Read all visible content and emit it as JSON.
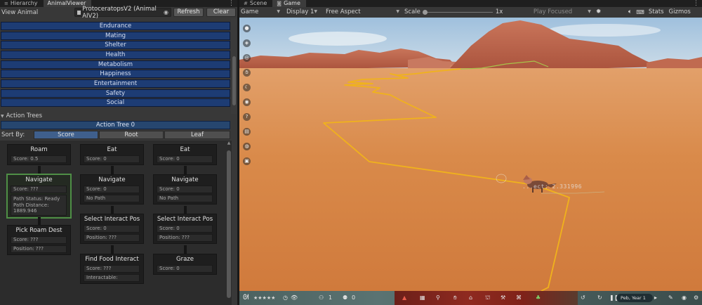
{
  "left_tabs": [
    {
      "label": "Hierarchy",
      "icon": "list-icon"
    },
    {
      "label": "AnimalViewer",
      "icon": ""
    }
  ],
  "toolbar": {
    "view_label": "View Animal",
    "animal_field": "ProtoceratopsV2 (Animal AIV2)",
    "refresh_label": "Refresh",
    "clear_label": "Clear"
  },
  "needs": [
    "Endurance",
    "Mating",
    "Shelter",
    "Health",
    "Metabolism",
    "Happiness",
    "Entertainment",
    "Safety",
    "Social"
  ],
  "action_trees": {
    "foldout_label": "Action Trees",
    "tree_label": "Action Tree 0",
    "sort_label": "Sort By:",
    "sort_options": [
      "Score",
      "Root",
      "Leaf"
    ],
    "sort_selected": "Score"
  },
  "nodes": {
    "col1": [
      {
        "title": "Roam",
        "fields": [
          "Score: 0.5"
        ]
      },
      {
        "title": "Navigate",
        "fields": [
          "Score: ???",
          "Path Status: Ready Path Distance: 1889.946"
        ]
      },
      {
        "title": "Pick Roam Dest",
        "fields": [
          "Score: ???",
          "Position: ???"
        ]
      }
    ],
    "col2": [
      {
        "title": "Eat",
        "fields": [
          "Score: 0"
        ]
      },
      {
        "title": "Navigate",
        "fields": [
          "Score: 0",
          "No Path"
        ]
      },
      {
        "title": "Select Interact Pos",
        "fields": [
          "Score: 0",
          "Position: ???"
        ]
      },
      {
        "title": "Find Food Interact",
        "fields": [
          "Score: ???",
          "Interactable:"
        ]
      }
    ],
    "col3": [
      {
        "title": "Eat",
        "fields": [
          "Score: 0"
        ]
      },
      {
        "title": "Navigate",
        "fields": [
          "Score: 0",
          "No Path"
        ]
      },
      {
        "title": "Select Interact Pos",
        "fields": [
          "Score: 0",
          "Position: ???"
        ]
      },
      {
        "title": "Graze",
        "fields": [
          "Score: 0"
        ]
      }
    ]
  },
  "right_tabs": [
    {
      "label": "Scene",
      "icon": "hash-icon"
    },
    {
      "label": "Game",
      "icon": "gamepad-icon"
    }
  ],
  "game_toolbar": {
    "display_mode": "Game",
    "display": "Display 1",
    "aspect": "Free Aspect",
    "scale_label": "Scale",
    "scale_value": "1x",
    "play_mode": "Play Focused",
    "stats_label": "Stats",
    "gizmos_label": "Gizmos"
  },
  "world_label": "...ect: 2.331996",
  "hud": {
    "stars": "★★★★★",
    "count1": "1",
    "count2": "0",
    "date_pill": "Peb, Year 1"
  },
  "colors": {
    "need_bar": "#1d3c74",
    "selected_node": "#4f8f46",
    "path_line": "#f0b21c",
    "sand": "#d98a4a"
  }
}
